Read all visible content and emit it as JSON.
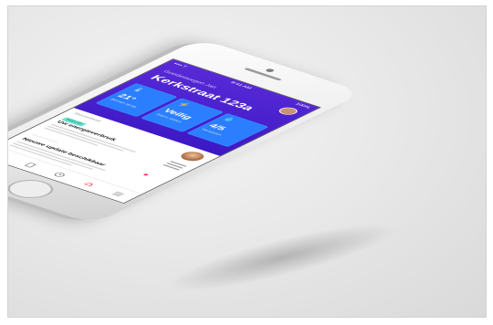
{
  "status_bar": {
    "left": "•••• T",
    "time": "9:41 AM",
    "right": "100%"
  },
  "header": {
    "greeting": "Goedemorgen Jan",
    "address": "Kerkstraat 123a"
  },
  "tiles": [
    {
      "icon": "thermometer-icon",
      "value": "21°",
      "sub": "Binnen temp."
    },
    {
      "icon": "bolt-icon",
      "value": "Veilig",
      "sub": "Alarm status"
    },
    {
      "icon": "drop-icon",
      "value": "4/5",
      "sub": "Sensoren"
    }
  ],
  "feed": {
    "label": "Nieuwsfeed",
    "badge": "NIEUW",
    "card_title": "Uw energieverbruik",
    "card_title_2": "Nieuwe update beschikbaar"
  },
  "nav": {
    "items": [
      "home-icon",
      "devices-icon",
      "clock-icon",
      "alerts-icon",
      "menu-icon"
    ]
  },
  "colors": {
    "header": "#4a22d0",
    "tile": "#2b7fff",
    "badge": "#6fe3cf",
    "alert_dot": "#ff3b56"
  }
}
